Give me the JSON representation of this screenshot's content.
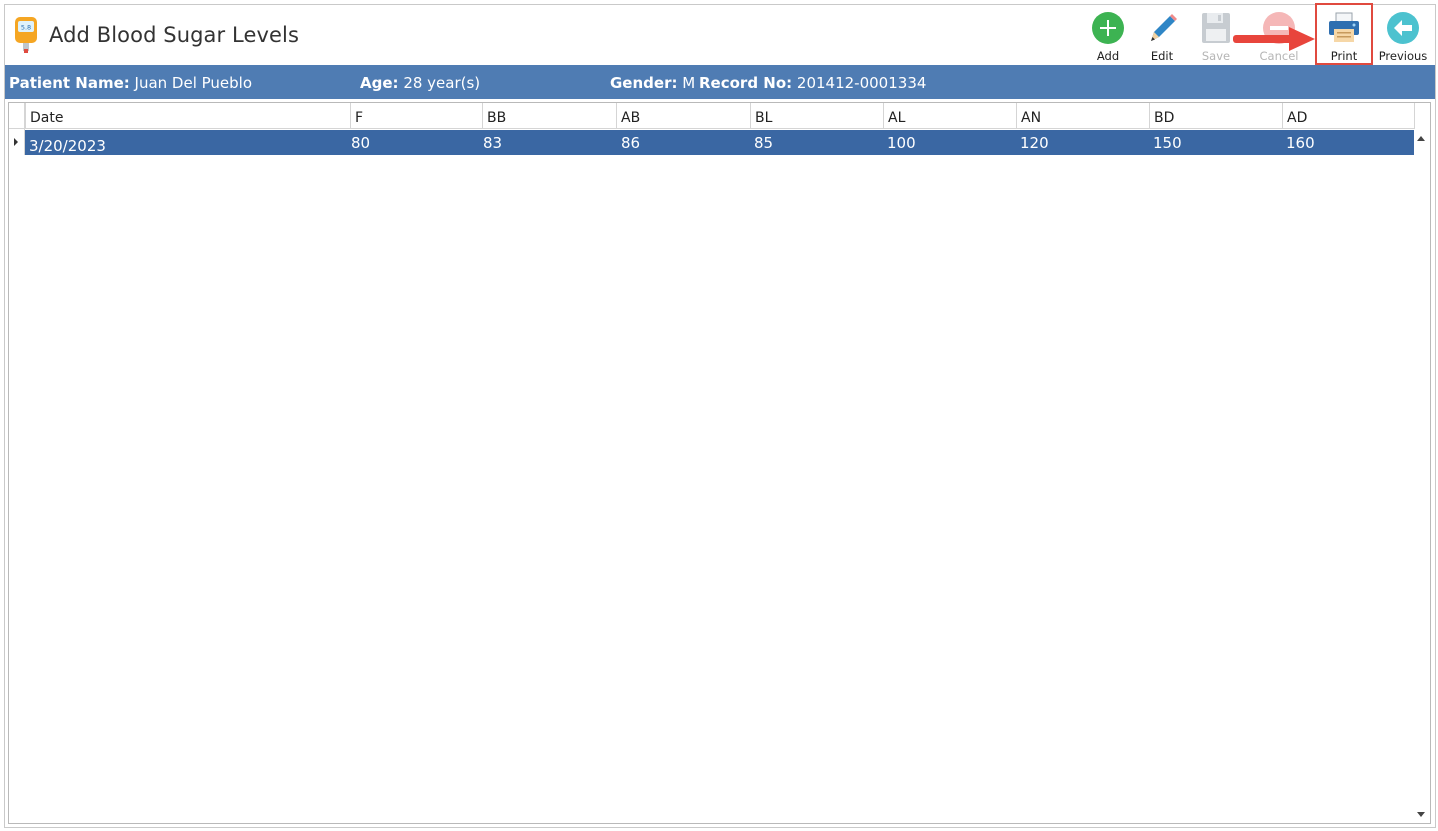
{
  "window": {
    "title": "Add Blood Sugar Levels",
    "icon": "glucose-meter-icon"
  },
  "toolbar": {
    "add_label": "Add",
    "edit_label": "Edit",
    "save_label": "Save",
    "cancel_label": "Cancel",
    "print_label": "Print",
    "previous_label": "Previous"
  },
  "patient": {
    "name_label": "Patient Name:",
    "name": "Juan Del Pueblo",
    "age_label": "Age:",
    "age": "28 year(s)",
    "gender_label": "Gender:",
    "gender": "M",
    "record_label": "Record No:",
    "record_no": "201412-0001334"
  },
  "grid": {
    "columns": [
      "Date",
      "F",
      "BB",
      "AB",
      "BL",
      "AL",
      "AN",
      "BD",
      "AD"
    ],
    "rows": [
      {
        "date": "3/20/2023",
        "F": "80",
        "BB": "83",
        "AB": "86",
        "BL": "85",
        "AL": "100",
        "AN": "120",
        "BD": "150",
        "AD": "160"
      }
    ]
  },
  "colors": {
    "info_bar": "#4f7cb3",
    "selected_row": "#3a67a3",
    "highlight_border": "#e04a3f",
    "add_green": "#3db352",
    "edit_blue": "#2f86c6",
    "previous_teal": "#4cc2cf"
  }
}
